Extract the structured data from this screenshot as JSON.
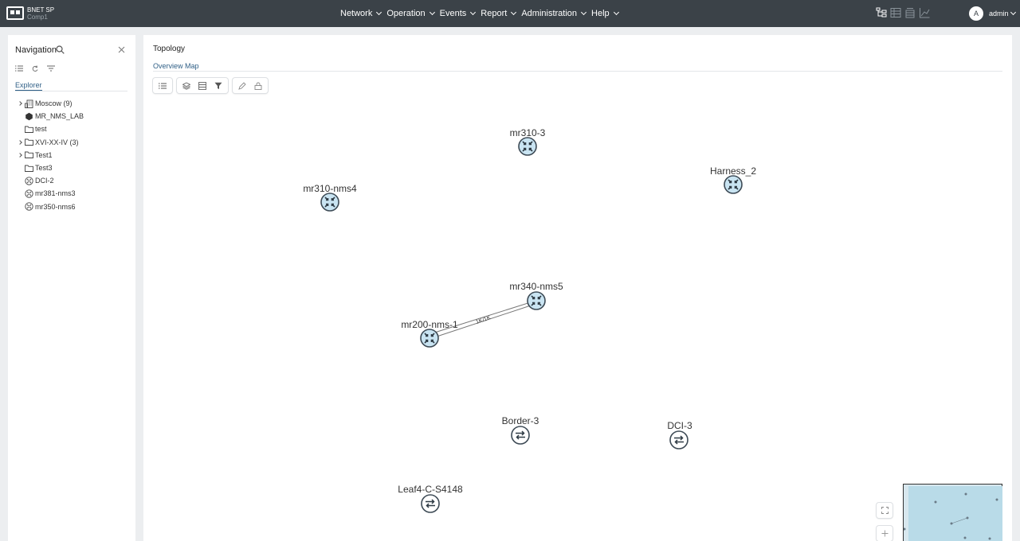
{
  "header": {
    "brand_name": "BNET SP",
    "brand_sub": "Comp1",
    "menu": [
      {
        "label": "Network"
      },
      {
        "label": "Operation"
      },
      {
        "label": "Events"
      },
      {
        "label": "Report"
      },
      {
        "label": "Administration"
      },
      {
        "label": "Help"
      }
    ],
    "toolbar_icons": [
      "topology-tree-icon",
      "table-icon",
      "archive-icon",
      "chart-icon"
    ],
    "avatar_letter": "A",
    "user_name": "admin"
  },
  "sidebar": {
    "title": "Navigation",
    "tab": "Explorer",
    "tree": [
      {
        "label": "Moscow (9)",
        "icon": "building-icon",
        "expandable": true
      },
      {
        "label": "MR_NMS_LAB",
        "icon": "hexagon-icon",
        "expandable": false
      },
      {
        "label": "test",
        "icon": "folder-icon",
        "expandable": false
      },
      {
        "label": "XVI-XX-IV (3)",
        "icon": "folder-icon",
        "expandable": true
      },
      {
        "label": "Test1",
        "icon": "folder-icon",
        "expandable": true
      },
      {
        "label": "Test3",
        "icon": "folder-icon",
        "expandable": false
      },
      {
        "label": "DCI-2",
        "icon": "router-icon",
        "expandable": false
      },
      {
        "label": "mr381-nms3",
        "icon": "router-icon",
        "expandable": false
      },
      {
        "label": "mr350-nms6",
        "icon": "router-icon",
        "expandable": false
      }
    ]
  },
  "main": {
    "title": "Topology",
    "tab": "Overview Map",
    "nodes": [
      {
        "name": "mr310-3",
        "kind": "router"
      },
      {
        "name": "Harness_2",
        "kind": "router"
      },
      {
        "name": "mr310-nms4",
        "kind": "router"
      },
      {
        "name": "mr340-nms5",
        "kind": "router"
      },
      {
        "name": "mr200-nms-1",
        "kind": "router"
      },
      {
        "name": "Border-3",
        "kind": "switch"
      },
      {
        "name": "DCI-3",
        "kind": "switch"
      },
      {
        "name": "Leaf4-C-S4148",
        "kind": "switch"
      }
    ],
    "links": [
      {
        "from": "mr200-nms-1",
        "to": "mr340-nms5",
        "label": "1K/1K"
      }
    ]
  },
  "colors": {
    "header_bg": "#3b4248",
    "accent": "#2f5f86",
    "node_fill": "#c9e4f2",
    "node_stroke": "#3d4a55"
  }
}
